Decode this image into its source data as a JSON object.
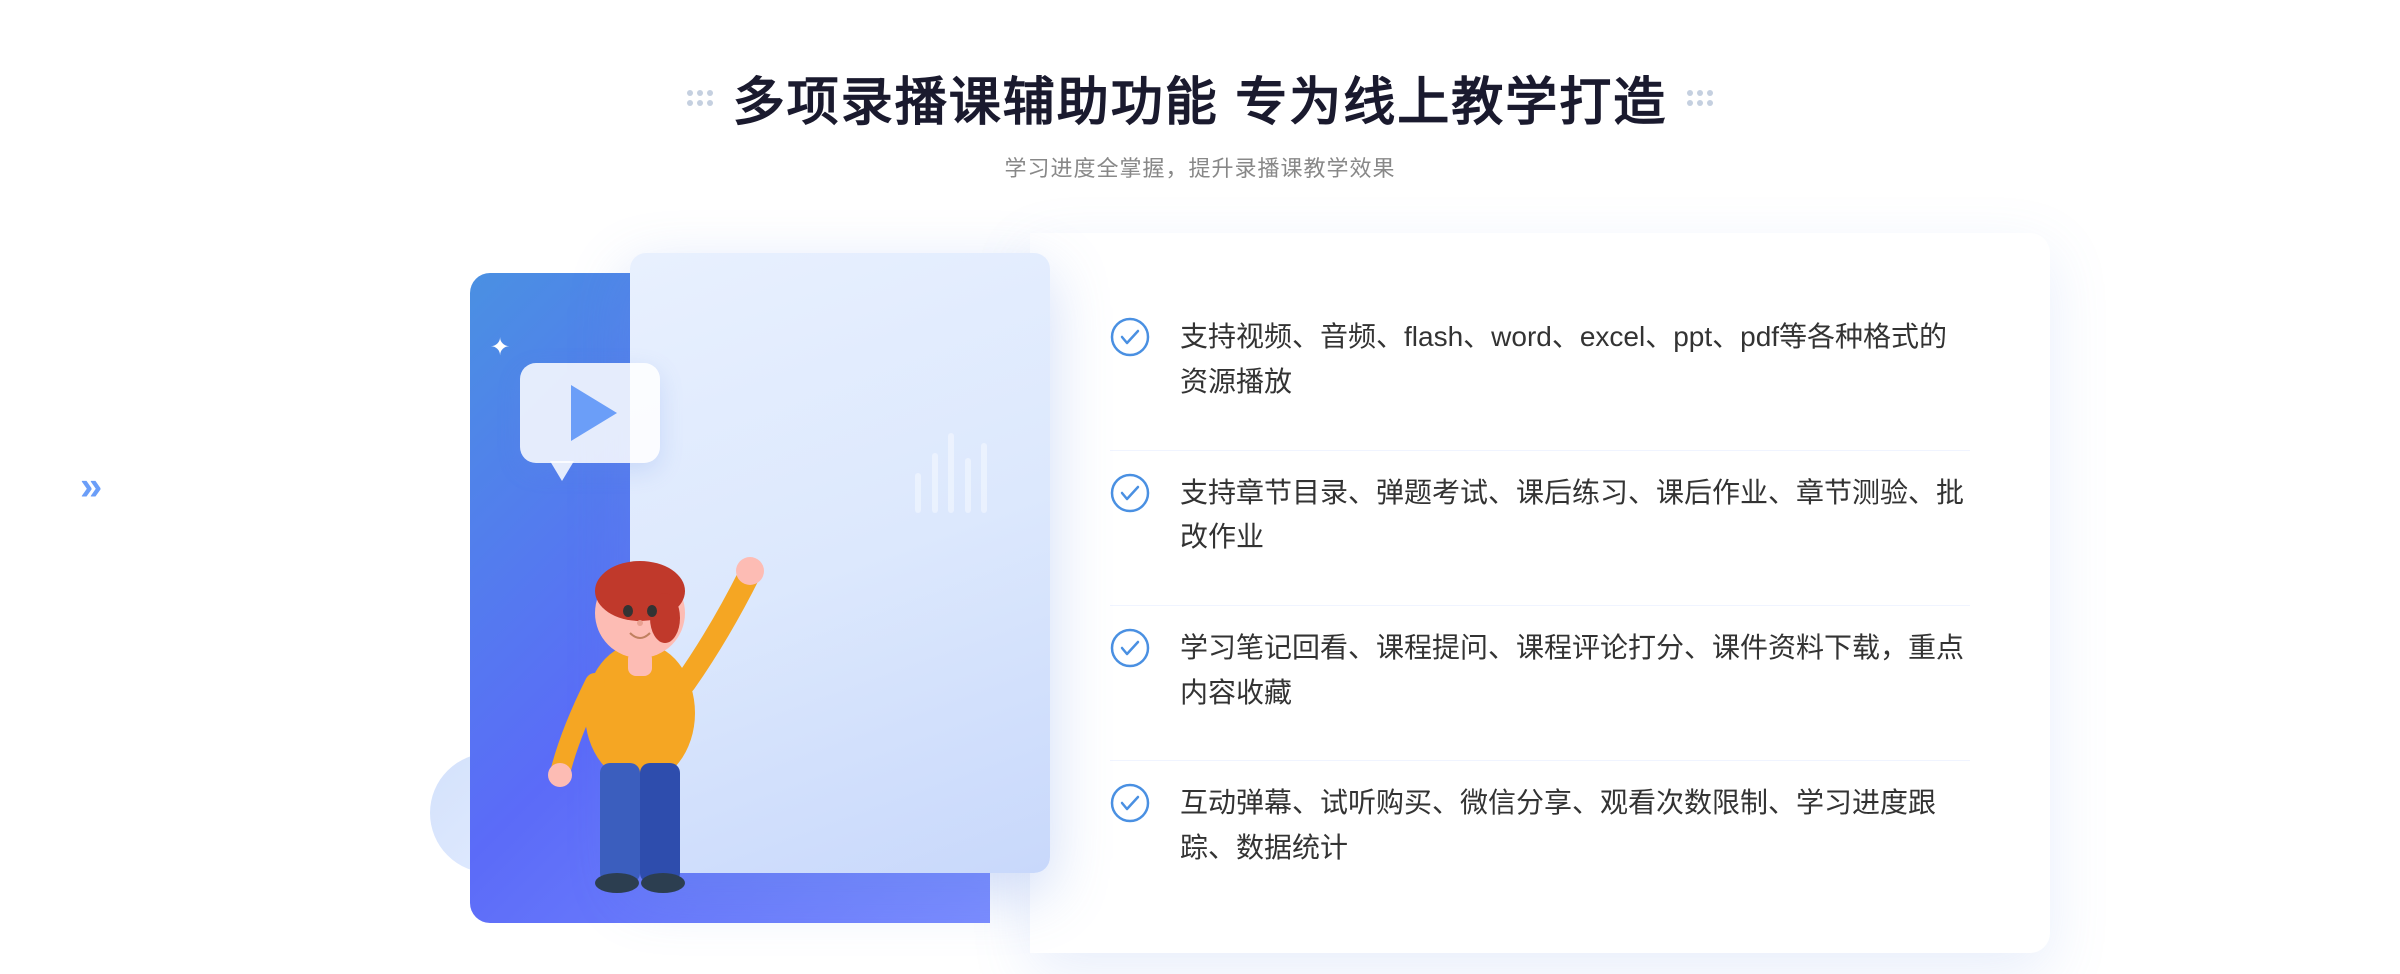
{
  "header": {
    "title": "多项录播课辅助功能 专为线上教学打造",
    "subtitle": "学习进度全掌握，提升录播课教学效果"
  },
  "features": [
    {
      "id": "feature-1",
      "text": "支持视频、音频、flash、word、excel、ppt、pdf等各种格式的资源播放"
    },
    {
      "id": "feature-2",
      "text": "支持章节目录、弹题考试、课后练习、课后作业、章节测验、批改作业"
    },
    {
      "id": "feature-3",
      "text": "学习笔记回看、课程提问、课程评论打分、课件资料下载，重点内容收藏"
    },
    {
      "id": "feature-4",
      "text": "互动弹幕、试听购买、微信分享、观看次数限制、学习进度跟踪、数据统计"
    }
  ],
  "decorations": {
    "chevrons": "»",
    "star": "✦",
    "check_color": "#4a90e2"
  }
}
